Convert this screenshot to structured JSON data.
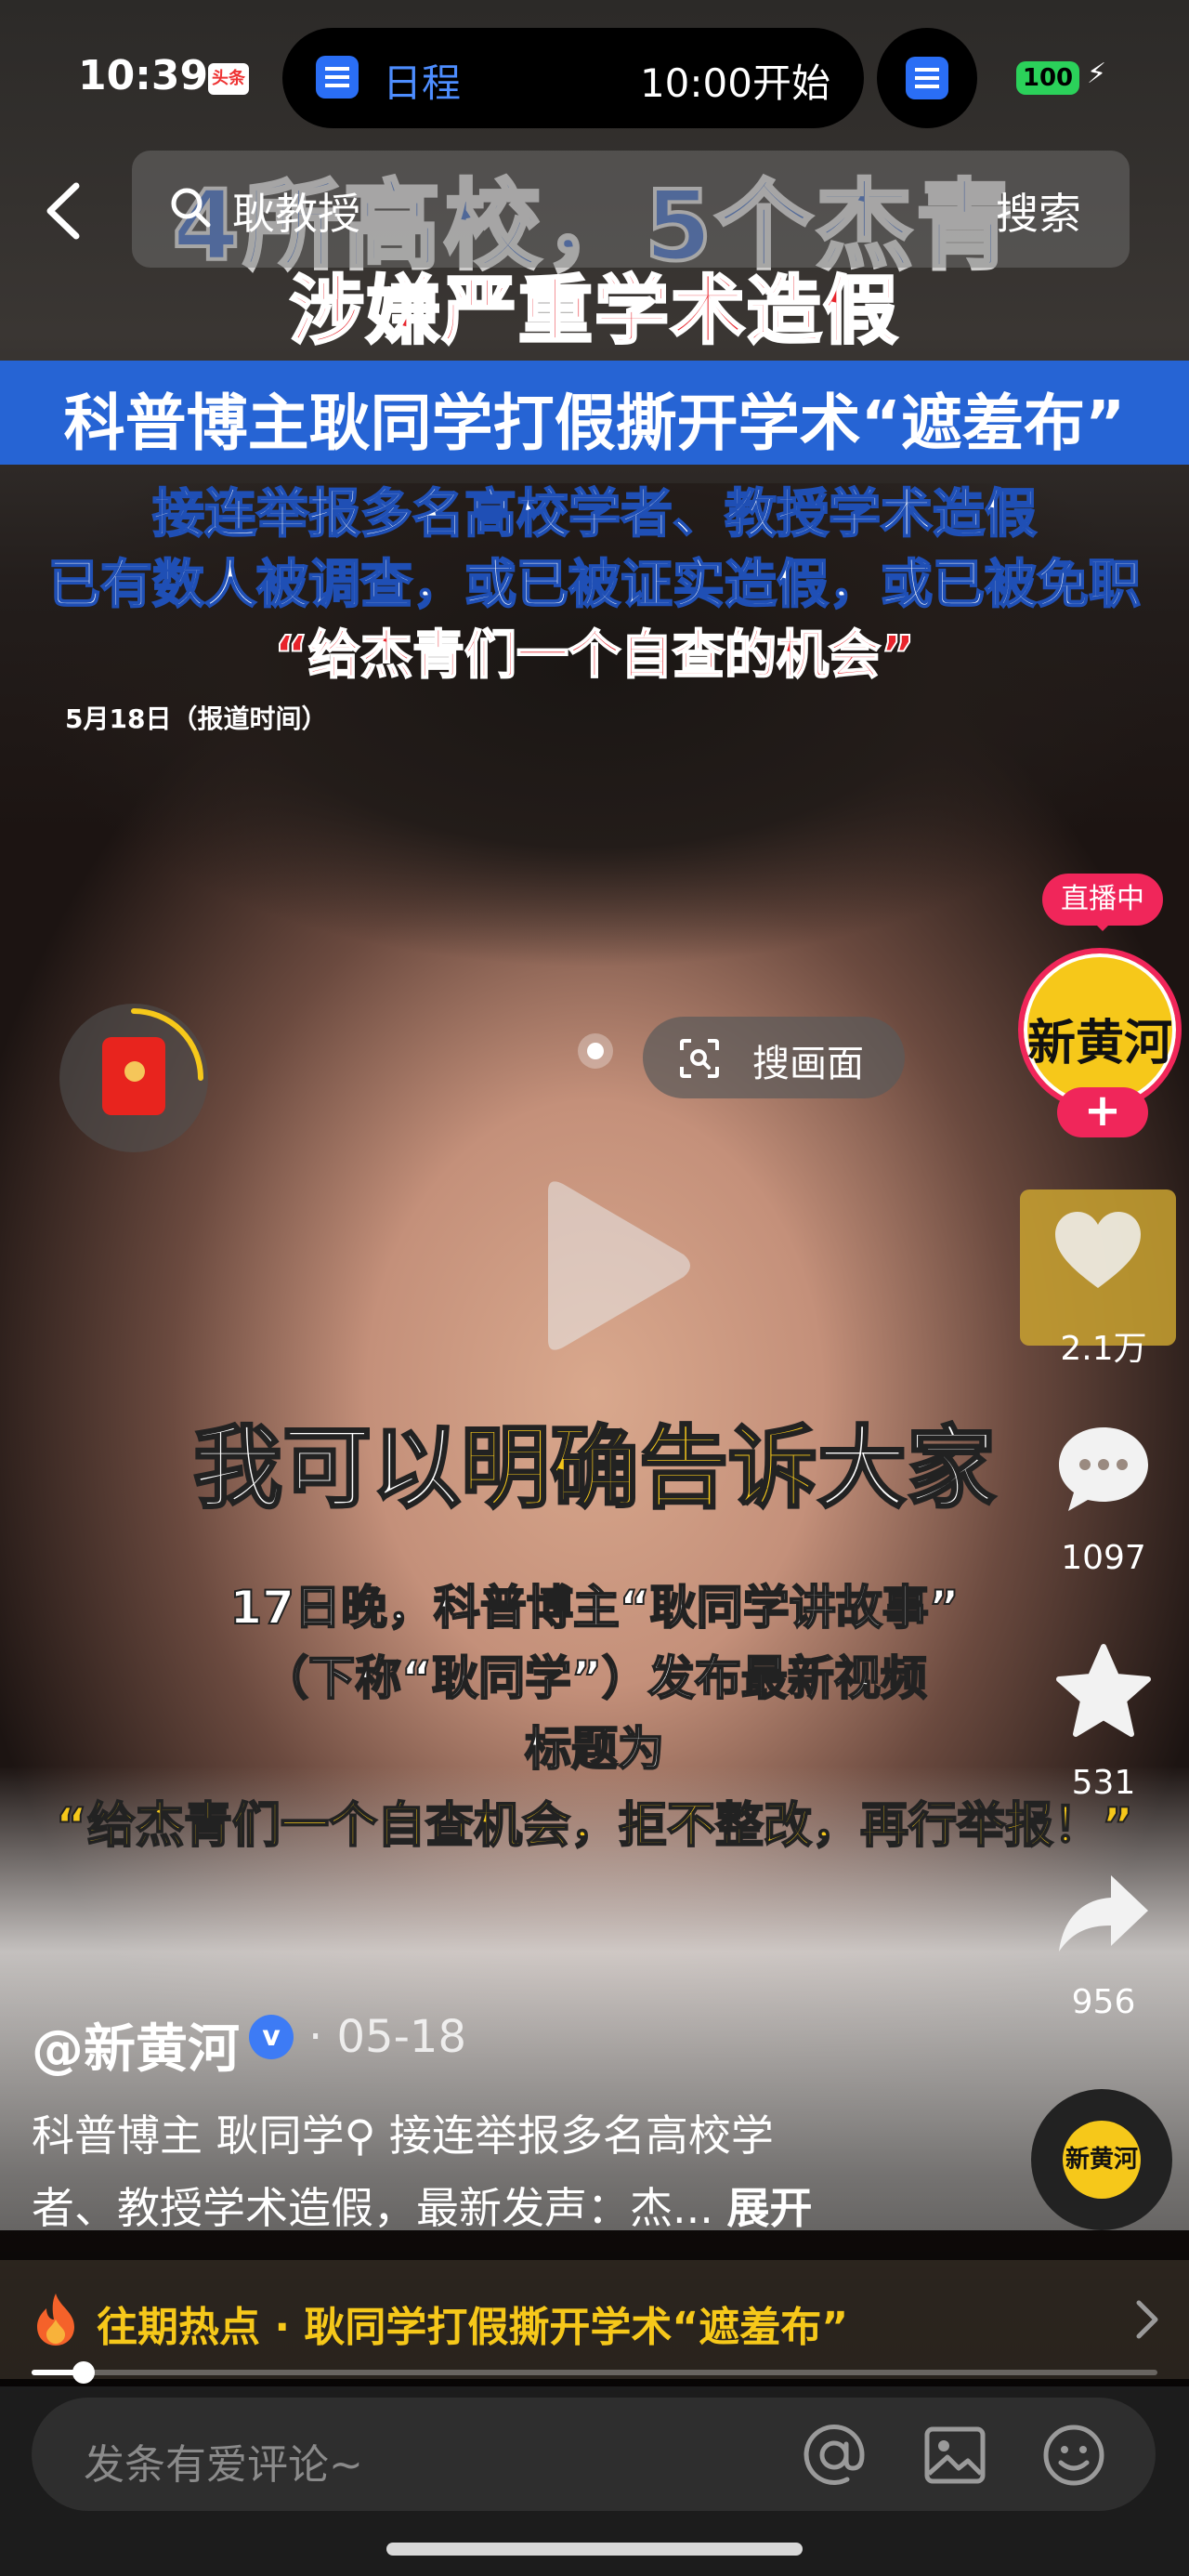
{
  "status": {
    "time": "10:39",
    "app_badge": "头条",
    "island_label": "日程",
    "island_time": "10:00开始",
    "battery": "100"
  },
  "search": {
    "query": "耿教授",
    "button": "搜索"
  },
  "video_overlay": {
    "title_line1": "4所高校，5个杰青",
    "title_line2": "涉嫌严重学术造假",
    "banner": "科普博主耿同学打假撕开学术“遮羞布”",
    "sub_line1": "接连举报多名高校学者、教授学术造假",
    "sub_line2": "已有数人被调查，或已被证实造假，或已被免职",
    "quote": "“给杰青们一个自查的机会”",
    "date_note": "5月18日（报道时间）"
  },
  "captions": {
    "main_prefix": "我可以",
    "main_highlight": "明确告诉",
    "main_suffix": "大家",
    "line1": "17日晚，科普博主“耿同学讲故事”",
    "line2": "（下称“耿同学”）发布最新视频",
    "line3": "标题为",
    "quote": "“给杰青们一个自查机会，拒不整改，再行举报！”"
  },
  "search_frame": {
    "label": "搜画面"
  },
  "right_rail": {
    "live_badge": "直播中",
    "avatar_text": "新黄河",
    "follow": "+",
    "like_count": "2.1万",
    "comment_count": "1097",
    "favorite_count": "531",
    "share_count": "956",
    "music_text": "新黄河"
  },
  "post": {
    "author": "@新黄河",
    "verified_mark": "v",
    "date": "· 05-18",
    "desc_line1": "科普博主 耿同学⚲ 接连举报多名高校学",
    "desc_line2": "者、教授学术造假，最新发声：杰... ",
    "expand": "展开"
  },
  "hot": {
    "text": "往期热点 · 耿同学打假撕开学术“遮羞布”"
  },
  "progress": {
    "fraction": 0.046
  },
  "comment_bar": {
    "placeholder": "发条有爱评论~"
  },
  "colors": {
    "accent_pink": "#f0265a",
    "brand_yellow": "#f6c81a",
    "banner_blue": "#2664d4",
    "title_red": "#e8242c"
  }
}
